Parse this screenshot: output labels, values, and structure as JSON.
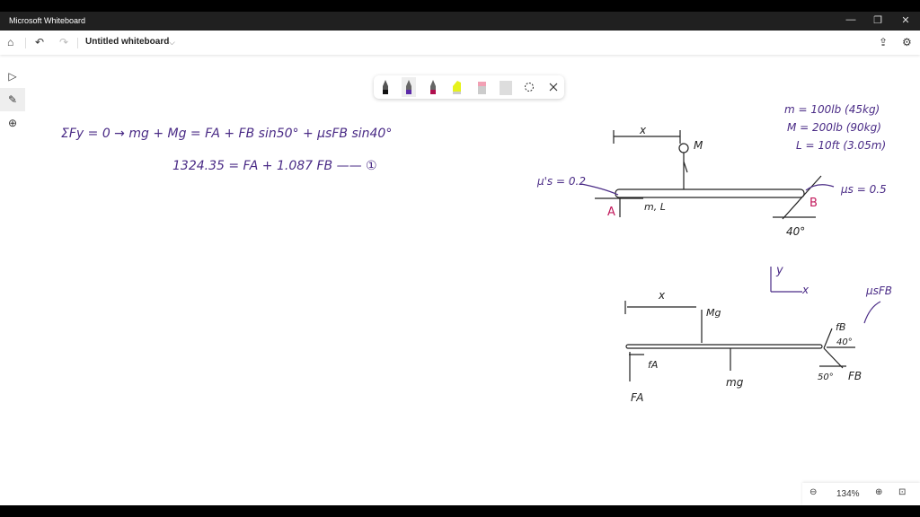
{
  "window": {
    "title": "Microsoft Whiteboard",
    "minimize_icon": "minimize-icon",
    "restore_icon": "restore-icon",
    "close_icon": "close-icon"
  },
  "appbar": {
    "board_title": "Untitled whiteboard",
    "icons": [
      "home-icon",
      "undo-icon",
      "redo-icon",
      "chevron-down-icon",
      "share-icon",
      "gear-icon"
    ]
  },
  "left_tools": [
    "select-icon",
    "pen-icon",
    "add-icon"
  ],
  "pen_tray": {
    "pens": [
      {
        "name": "black-pen",
        "color": "#1a1a1a"
      },
      {
        "name": "purple-pen",
        "color": "#5b2aa8"
      },
      {
        "name": "magenta-pen",
        "color": "#b0104e"
      },
      {
        "name": "highlighter",
        "color": "#e6f21c"
      },
      {
        "name": "eraser",
        "color": "#f2a0b4"
      },
      {
        "name": "ruler",
        "color": "#d8d8d8"
      }
    ],
    "selected": "purple-pen"
  },
  "zoom": {
    "level": "134%"
  },
  "board": {
    "colors": {
      "ink": "#4a2b86",
      "black_ink": "#222222",
      "label_red": "#c2185b"
    },
    "equation1": "ΣFy = 0  →  mg + Mg = FA + FB sin50° + μsFB sin40°",
    "equation2": "1324.35 = FA + 1.087 FB —— ①",
    "givens": [
      "m = 100lb (45kg)",
      "M = 200lb (90kg)",
      "L = 10ft (3.05m)"
    ],
    "diagram1": {
      "x": "x",
      "person": "M",
      "mu_a": "μ's = 0.2",
      "mu_b": "μs = 0.5",
      "point_a": "A",
      "point_b": "B",
      "beam": "m, L",
      "angle": "40°"
    },
    "diagram2": {
      "axis_y": "y",
      "axis_x": "x",
      "x": "x",
      "Mg": "Mg",
      "mg": "mg",
      "fA": "fA",
      "FA": "FA",
      "fB": "fB",
      "FB": "FB",
      "muFB": "μsFB",
      "angle40": "40°",
      "angle50": "50°"
    }
  }
}
